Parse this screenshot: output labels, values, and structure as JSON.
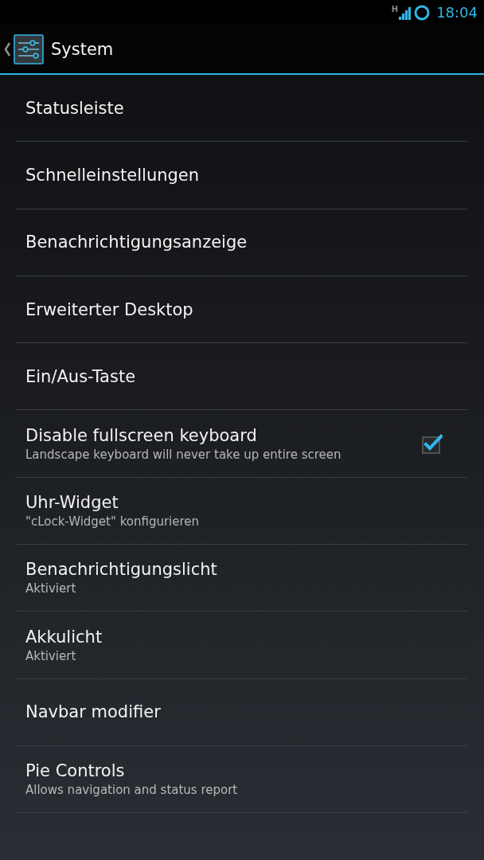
{
  "status_bar": {
    "network_type": "H",
    "time": "18:04"
  },
  "action_bar": {
    "title": "System"
  },
  "items": [
    {
      "kind": "plain",
      "title": "Statusleiste"
    },
    {
      "kind": "plain",
      "title": "Schnelleinstellungen"
    },
    {
      "kind": "plain",
      "title": "Benachrichtigungsanzeige"
    },
    {
      "kind": "plain",
      "title": "Erweiterter Desktop"
    },
    {
      "kind": "plain",
      "title": "Ein/Aus-Taste"
    },
    {
      "kind": "checkbox",
      "title": "Disable fullscreen keyboard",
      "summary": "Landscape keyboard will never take up entire screen",
      "checked": true
    },
    {
      "kind": "plain",
      "title": "Uhr-Widget",
      "summary": "\"cLock-Widget\" konfigurieren"
    },
    {
      "kind": "plain",
      "title": "Benachrichtigungslicht",
      "summary": "Aktiviert"
    },
    {
      "kind": "plain",
      "title": "Akkulicht",
      "summary": "Aktiviert"
    },
    {
      "kind": "plain",
      "title": "Navbar modifier"
    },
    {
      "kind": "plain",
      "title": "Pie Controls",
      "summary": "Allows navigation and status report"
    }
  ]
}
